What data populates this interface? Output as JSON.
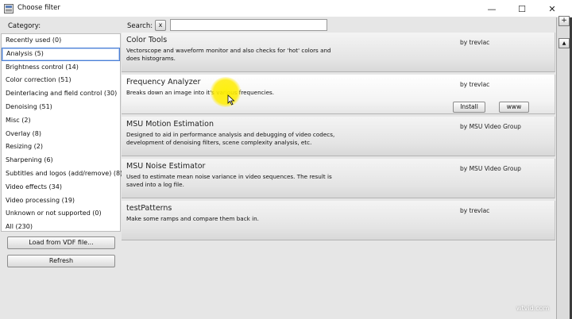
{
  "window": {
    "title": "Choose filter",
    "icon": "filter-app-icon",
    "minimize_glyph": "—",
    "maximize_glyph": "☐",
    "close_glyph": "✕"
  },
  "search": {
    "label": "Search:",
    "clear_label": "x",
    "value": "",
    "placeholder": ""
  },
  "category": {
    "label": "Category:",
    "selected_index": 1,
    "items": [
      "Recently used (0)",
      "Analysis (5)",
      "Brightness control (14)",
      "Color correction (51)",
      "Deinterlacing and field control (30)",
      "Denoising (51)",
      "Misc (2)",
      "Overlay (8)",
      "Resizing (2)",
      "Sharpening (6)",
      "Subtitles and logos (add/remove) (8)",
      "Video effects (34)",
      "Video processing (19)",
      "Unknown or not supported (0)",
      "All (230)"
    ]
  },
  "buttons": {
    "load_vdf": "Load from VDF file...",
    "refresh": "Refresh"
  },
  "filters": [
    {
      "name": "Color Tools",
      "author": "by trevlac",
      "description": "Vectorscope and waveform monitor and also checks for 'hot' colors and does histograms."
    },
    {
      "name": "Frequency Analyzer",
      "author": "by trevlac",
      "description": "Breaks down an image into it's various frequencies.",
      "install_label": "Install",
      "www_label": "www"
    },
    {
      "name": "MSU Motion Estimation",
      "author": "by MSU Video Group",
      "description": "Designed to aid in performance analysis and debugging of video codecs, development of denoising filters, scene complexity analysis, etc."
    },
    {
      "name": "MSU Noise Estimator",
      "author": "by MSU Video Group",
      "description": "Used to estimate mean noise variance in video sequences. The result is saved into a log file."
    },
    {
      "name": "testPatterns",
      "author": "by trevlac",
      "description": "Make some ramps and compare them back in."
    }
  ],
  "side_strip": {
    "plus_glyph": "+",
    "up_glyph": "▲"
  },
  "watermark": "wtvid.com",
  "colors": {
    "selection_border": "#4a7fd6",
    "cursor_highlight": "#ffec00"
  }
}
